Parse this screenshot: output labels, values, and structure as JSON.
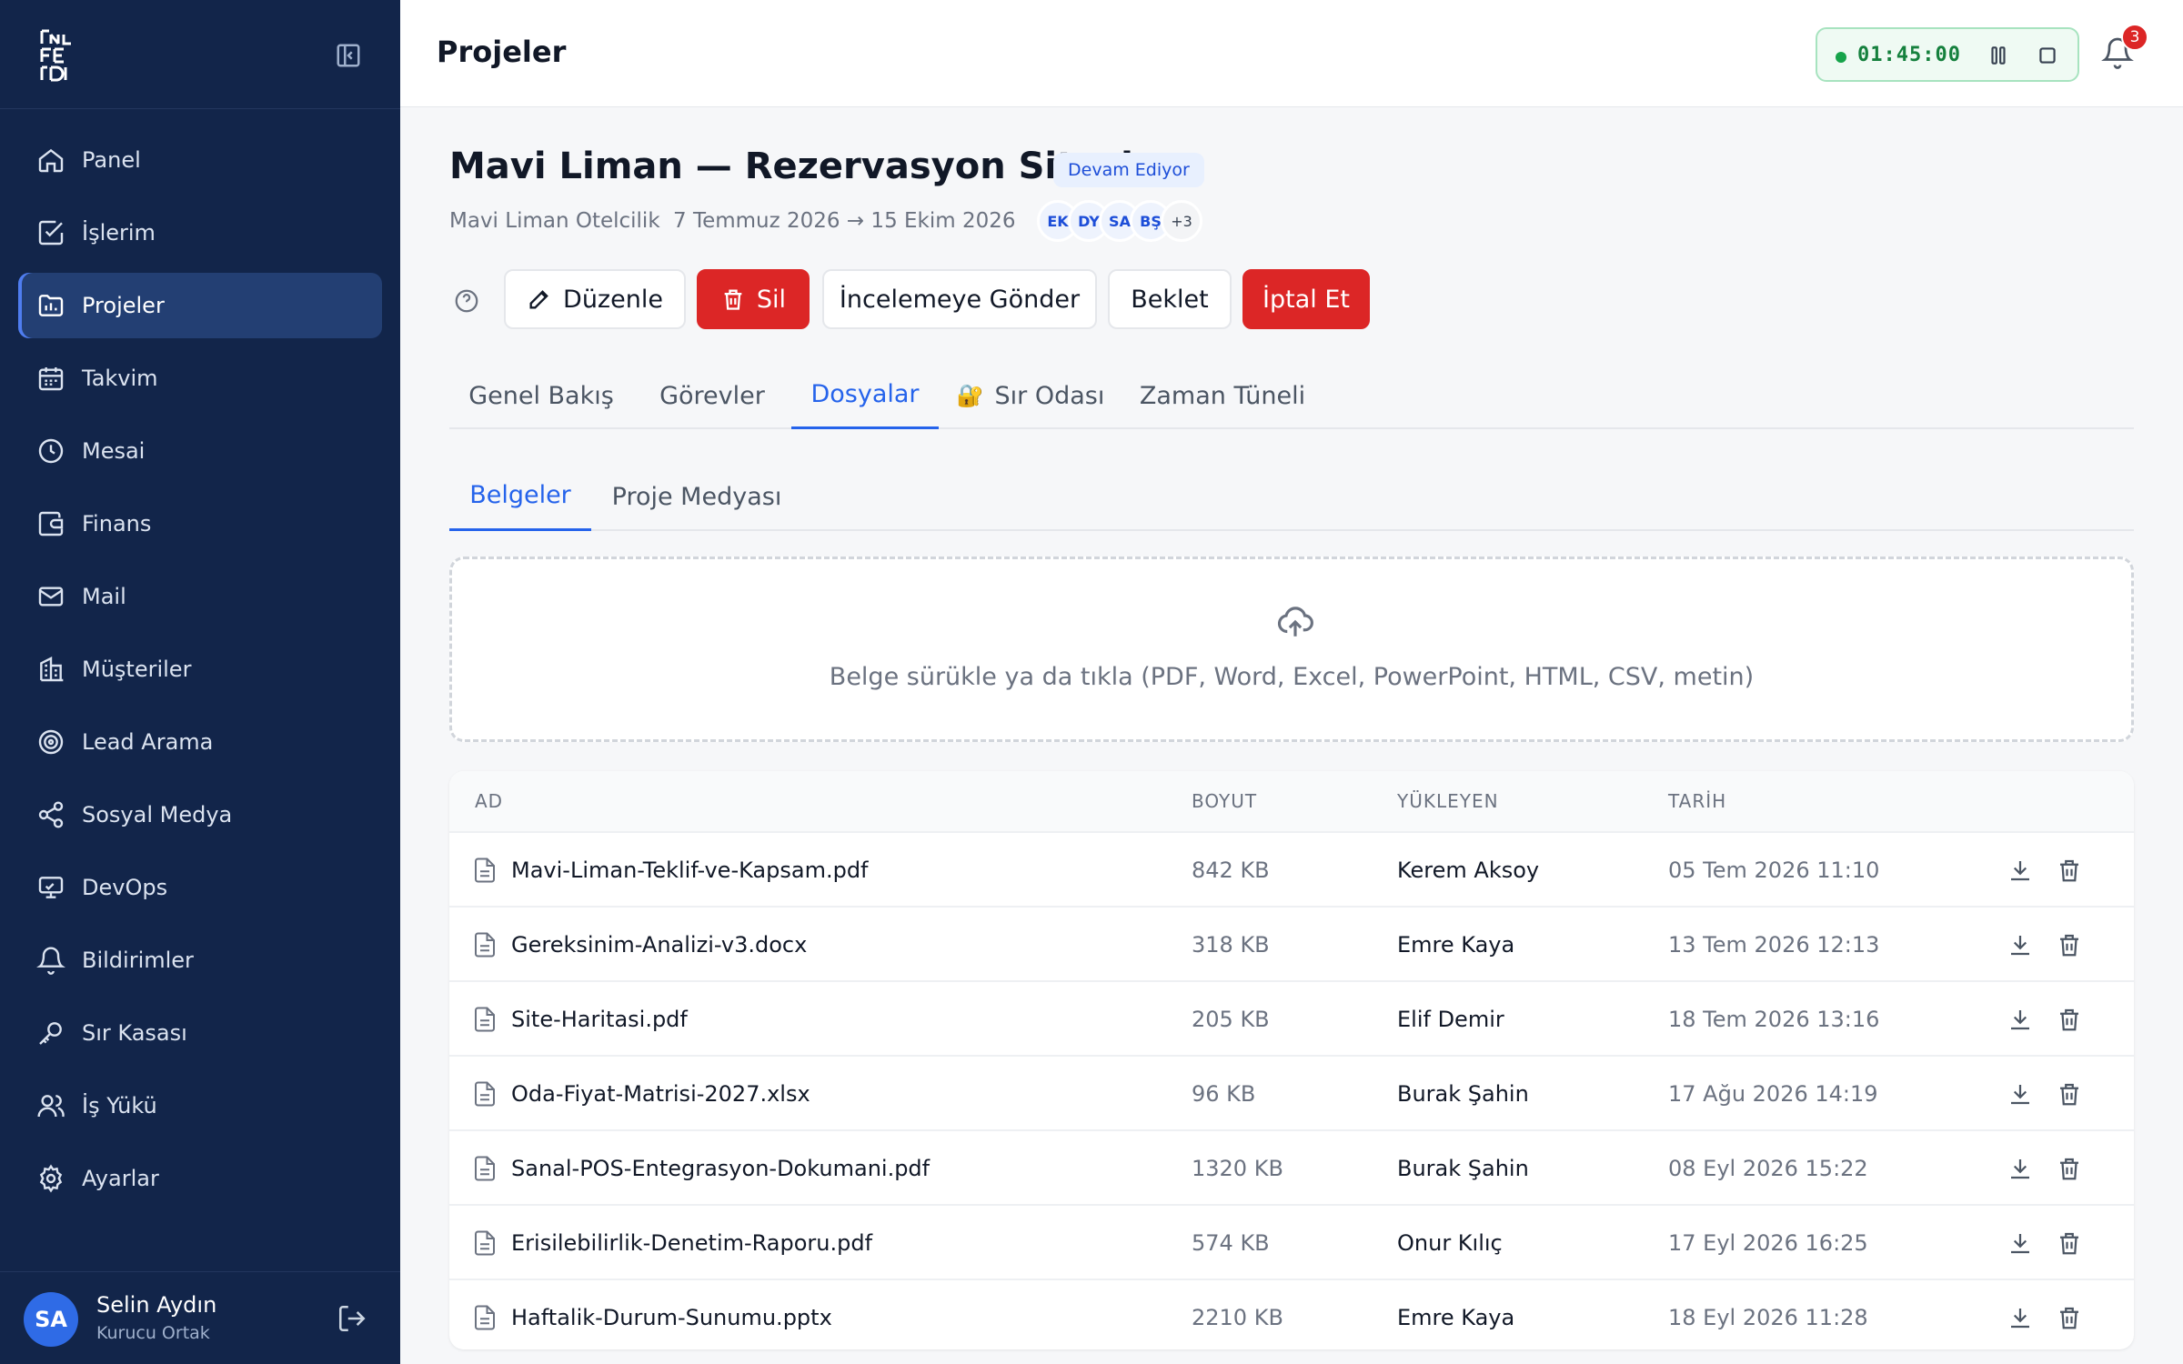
{
  "sidebar": {
    "items": [
      {
        "label": "Panel",
        "icon": "home-icon"
      },
      {
        "label": "İşlerim",
        "icon": "check-square-icon"
      },
      {
        "label": "Projeler",
        "icon": "folder-chart-icon"
      },
      {
        "label": "Takvim",
        "icon": "calendar-icon"
      },
      {
        "label": "Mesai",
        "icon": "clock-icon"
      },
      {
        "label": "Finans",
        "icon": "wallet-icon"
      },
      {
        "label": "Mail",
        "icon": "mail-icon"
      },
      {
        "label": "Müşteriler",
        "icon": "building-icon"
      },
      {
        "label": "Lead Arama",
        "icon": "target-icon"
      },
      {
        "label": "Sosyal Medya",
        "icon": "share-icon"
      },
      {
        "label": "DevOps",
        "icon": "monitor-icon"
      },
      {
        "label": "Bildirimler",
        "icon": "bell-icon"
      },
      {
        "label": "Sır Kasası",
        "icon": "key-icon"
      },
      {
        "label": "İş Yükü",
        "icon": "users-icon"
      },
      {
        "label": "Ayarlar",
        "icon": "gear-icon"
      }
    ],
    "active_index": 2,
    "user": {
      "initials": "SA",
      "name": "Selin Aydın",
      "role": "Kurucu Ortak"
    }
  },
  "header": {
    "title": "Projeler",
    "timer": "01:45:00",
    "notification_count": "3"
  },
  "project": {
    "title": "Mavi Liman — Rezervasyon Sitesi",
    "status": "Devam Ediyor",
    "client": "Mavi Liman Otelcilik",
    "dates": "7 Temmuz 2026 → 15 Ekim 2026",
    "team": [
      "EK",
      "DY",
      "SA",
      "BŞ"
    ],
    "team_more": "+3"
  },
  "actions": {
    "edit": "Düzenle",
    "delete": "Sil",
    "send_review": "İncelemeye Gönder",
    "hold": "Beklet",
    "cancel": "İptal Et"
  },
  "tabs": [
    "Genel Bakış",
    "Görevler",
    "Dosyalar",
    "Sır Odası",
    "Zaman Tüneli"
  ],
  "active_tab": 2,
  "subtabs": [
    "Belgeler",
    "Proje Medyası"
  ],
  "active_subtab": 0,
  "dropzone": {
    "text": "Belge sürükle ya da tıkla (PDF, Word, Excel, PowerPoint, HTML, CSV, metin)"
  },
  "files": {
    "columns": [
      "AD",
      "BOYUT",
      "YÜKLEYEN",
      "TARİH"
    ],
    "rows": [
      {
        "name": "Mavi-Liman-Teklif-ve-Kapsam.pdf",
        "size": "842 KB",
        "user": "Kerem Aksoy",
        "date": "05 Tem 2026 11:10"
      },
      {
        "name": "Gereksinim-Analizi-v3.docx",
        "size": "318 KB",
        "user": "Emre Kaya",
        "date": "13 Tem 2026 12:13"
      },
      {
        "name": "Site-Haritasi.pdf",
        "size": "205 KB",
        "user": "Elif Demir",
        "date": "18 Tem 2026 13:16"
      },
      {
        "name": "Oda-Fiyat-Matrisi-2027.xlsx",
        "size": "96 KB",
        "user": "Burak Şahin",
        "date": "17 Ağu 2026 14:19"
      },
      {
        "name": "Sanal-POS-Entegrasyon-Dokumani.pdf",
        "size": "1320 KB",
        "user": "Burak Şahin",
        "date": "08 Eyl 2026 15:22"
      },
      {
        "name": "Erisilebilirlik-Denetim-Raporu.pdf",
        "size": "574 KB",
        "user": "Onur Kılıç",
        "date": "17 Eyl 2026 16:25"
      },
      {
        "name": "Haftalik-Durum-Sunumu.pptx",
        "size": "2210 KB",
        "user": "Emre Kaya",
        "date": "18 Eyl 2026 11:28"
      }
    ]
  },
  "colors": {
    "sidebar_bg": "#12254a",
    "active_nav": "#233f73",
    "accent": "#2563eb",
    "danger": "#dc2626",
    "timer_green": "#16a34a"
  }
}
